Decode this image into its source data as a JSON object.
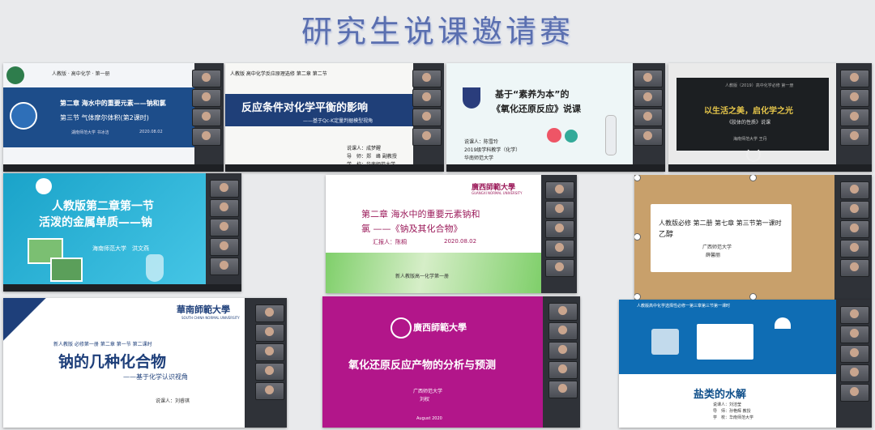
{
  "page_title": "研究生说课邀请赛",
  "slides": {
    "s1": {
      "header": "人教版 · 高中化学 · 第一册",
      "line1": "第二章 海水中的重要元素——钠和氯",
      "line2": "第三节 气体摩尔体积(第2课时)",
      "school": "湖南师范大学 书冰洁",
      "date": "2020.08.02"
    },
    "s2": {
      "header": "人教版 高中化学反应原理选修 第二章 第二节",
      "title": "反应条件对化学平衡的影响",
      "subtitle": "——基于Qc-K定量判据模型视角",
      "presenter": "说课人：成梦醒",
      "advisor": "导　师：郑　峰 副教授",
      "school": "学　校：华南师范大学"
    },
    "s3": {
      "title1": "基于“素养为本”的",
      "title2": "《氧化还原反应》说课",
      "presenter": "说课人：陈雪玲",
      "cohort": "2019级学科教学（化学）",
      "school": "华南师范大学"
    },
    "s4": {
      "header": "人教版（2019）高中化学必修 第一册",
      "title": "以生活之美，启化学之光",
      "subtitle": "《胶体的性质》说课",
      "school": "海南师范大学 王丹"
    },
    "s5": {
      "line1": "人教版第二章第一节",
      "line2": "活泼的金属单质——钠",
      "school": "海南师范大学　洪文燕"
    },
    "s6": {
      "brand": "廣西師範大學",
      "brand_en": "GUANGXI NORMAL UNIVERSITY",
      "title1": "第二章 海水中的重要元素钠和",
      "title2": "氯 ——《钠及其化合物》",
      "presenter": "汇报人：陈桐",
      "date": "2020.08.02",
      "book": "新人教版高一化学第一册"
    },
    "s7": {
      "line1": "人教版必修 第二册 第七章 第三节第一课时",
      "line2": "乙醇",
      "school": "广西师范大学",
      "name": "薛馨丽"
    },
    "s8": {
      "brand": "華南師範大學",
      "brand_en": "SOUTH CHINA NORMAL UNIVERSITY",
      "book": "新人教版 必修第一册 第二章 第一节 第二课时",
      "title": "钠的几种化合物",
      "subtitle": "——基于化学认识视角",
      "presenter": "说课人：刘睿琪"
    },
    "s9": {
      "brand": "廣西師範大學",
      "title": "氧化还原反应产物的分析与预测",
      "school": "广西师范大学",
      "name": "刘权",
      "date": "August 2020"
    },
    "s10": {
      "top": "人教版高中化学选择性必修一第三章第三节第一课时",
      "title": "盐类的水解",
      "presenter": "说课人：刘洁莹",
      "advisor": "导　师：孙艳辉 教授",
      "school": "学　校：华南师范大学"
    }
  }
}
